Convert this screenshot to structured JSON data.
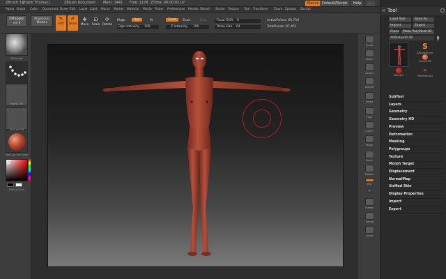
{
  "titlebar": {
    "app": "ZBrush 3.1",
    "user": "[Frank Thomas]",
    "document": "ZBrush Document",
    "mem": "Mem: 1441 ",
    "free": "Free: 1178",
    "ztime": "ZTime: 00:00:02.07",
    "menus_button": "Menus",
    "script_button": "DefaultZScript",
    "help_button": "Help"
  },
  "menubar": {
    "items": [
      "Alpha",
      "Brush",
      "Color",
      "Document",
      "Draw",
      "Edit",
      "Layer",
      "Light",
      "Macro",
      "Marker",
      "Material",
      "Movie",
      "Picker",
      "Preferences",
      "Render",
      "Stencil",
      "Stroke",
      "Texture",
      "Tool",
      "Transform",
      "Zoom",
      "Zplugin",
      "Zscript"
    ]
  },
  "shelf": {
    "zmapper": "ZMapper",
    "zmapper_sub": "rev-E",
    "projection": "Projection",
    "projection_sub": "Master",
    "edit": "Edit",
    "draw": "Draw",
    "move": "Move",
    "scale": "Scale",
    "rotate": "Rotate",
    "mrgb": "Mrgb",
    "rgb": "Rgb",
    "m": "M",
    "rgb_intensity_label": "Rgb Intensity",
    "rgb_intensity_value": "100",
    "zadd": "Zadd",
    "zsub": "Zsub",
    "zcut": "Zcut",
    "z_intensity_label": "Z Intensity",
    "z_intensity_value": "100",
    "focal_shift_label": "Focal Shift",
    "focal_shift_value": "0",
    "draw_size_label": "Draw Size",
    "draw_size_value": "64",
    "active_points": "ActivePoints: 69,759",
    "total_points": "TotalPoints: 87,451"
  },
  "leftshelf": {
    "thumbs": [
      "Standard",
      "Dots",
      "Alpha Off",
      "Texture Off",
      "MatCap Red Wax"
    ],
    "switch_color": "SwitchColor"
  },
  "rightshelf": {
    "buttons": [
      "Scroll",
      "Zoom",
      "Actual",
      "AAHalf",
      "Persp",
      "Floor",
      "L.Sym",
      "Move",
      "Scale",
      "Rotate",
      "XYZ",
      "",
      "Frame",
      "Transp",
      "Ghost"
    ]
  },
  "toolpanel": {
    "title": "Tool",
    "load_tool": "Load Tool",
    "save_as": "Save As",
    "import": "Import",
    "export": "Export",
    "clone": "Clone",
    "make_polymesh": "Make PolyMesh3D",
    "current_tool": "AllBody(00.49",
    "tool_thumbs": [
      "SimpleBrush",
      "Sphere3D",
      "ZSphere",
      "PolyMesh3D"
    ],
    "subpalettes": [
      "SubTool",
      "Layers",
      "Geometry",
      "Geometry HD",
      "Preview",
      "Deformation",
      "Masking",
      "Polygroups",
      "Texture",
      "Morph Target",
      "Displacement",
      "NormalMap",
      "Unified Skin",
      "Display Properties",
      "Import",
      "Export"
    ]
  },
  "colors": {
    "accent": "#e47a1a",
    "model": "#a4402f",
    "brush_ring": "#b3201c"
  }
}
